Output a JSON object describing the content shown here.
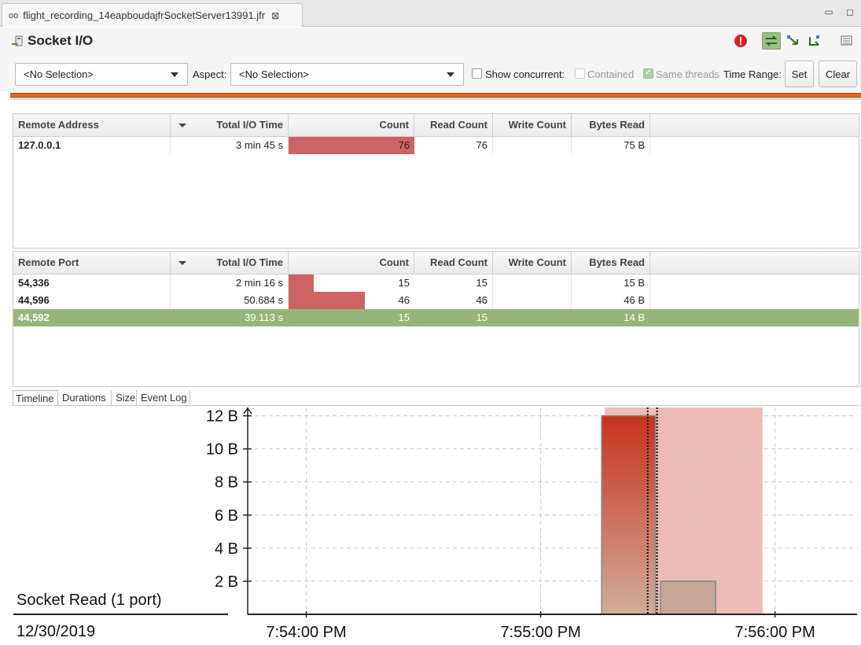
{
  "editor_tab": {
    "title": "flight_recording_14eapboudajfrSocketServer13991.jfr",
    "close_glyph": "⊠"
  },
  "window_controls": {
    "minimize": "▭",
    "maximize": "◻"
  },
  "page": {
    "title": "Socket I/O"
  },
  "filter": {
    "primary_combo": "<No Selection>",
    "aspect_label": "Aspect:",
    "aspect_combo": "<No Selection>",
    "show_concurrent": "Show concurrent:",
    "contained": "Contained",
    "same_threads": "Same threads",
    "time_range": "Time Range:",
    "set": "Set",
    "clear": "Clear"
  },
  "address_table": {
    "columns": [
      "Remote Address",
      "Total I/O Time",
      "Count",
      "Read Count",
      "Write Count",
      "Bytes Read"
    ],
    "rows": [
      {
        "remote": "127.0.0.1",
        "total_io_time": "3 min 45 s",
        "count": "76",
        "count_fraction": 1.0,
        "read_count": "76",
        "write_count": "",
        "bytes_read": "75 B"
      }
    ]
  },
  "port_table": {
    "columns": [
      "Remote Port",
      "Total I/O Time",
      "Count",
      "Read Count",
      "Write Count",
      "Bytes Read"
    ],
    "rows": [
      {
        "remote": "54,336",
        "total_io_time": "2 min 16 s",
        "count": "15",
        "count_fraction": 0.1974,
        "read_count": "15",
        "write_count": "",
        "bytes_read": "15 B"
      },
      {
        "remote": "44,596",
        "total_io_time": "50.684 s",
        "count": "46",
        "count_fraction": 0.6053,
        "read_count": "46",
        "write_count": "",
        "bytes_read": "46 B"
      },
      {
        "remote": "44,592",
        "total_io_time": "39.113 s",
        "count": "15",
        "count_fraction": 0.1974,
        "read_count": "15",
        "write_count": "",
        "bytes_read": "14 B",
        "selected": true
      }
    ]
  },
  "bottom_tabs": [
    "Timeline",
    "Durations",
    "Size",
    "Event Log"
  ],
  "colors": {
    "accent_range": "#e8641e",
    "selection": "#96b57a",
    "count_bar": "#cd6464"
  },
  "chart_data": {
    "type": "bar",
    "lane_label": "Socket Read (1 port)",
    "date_label": "12/30/2019",
    "x_ticks": [
      "7:54:00 PM",
      "7:55:00 PM",
      "7:56:00 PM"
    ],
    "x_tick_seconds": [
      0,
      60,
      120
    ],
    "y_ticks": [
      "2 B",
      "4 B",
      "6 B",
      "8 B",
      "10 B",
      "12 B"
    ],
    "y_tick_values": [
      2,
      4,
      6,
      8,
      10,
      12
    ],
    "xlim_seconds": [
      -15,
      141
    ],
    "ylim": [
      0,
      12.6
    ],
    "grid": true,
    "bars": [
      {
        "start_s": 75.6,
        "end_s": 89.4,
        "value": 12,
        "style": "gradient"
      },
      {
        "start_s": 90.7,
        "end_s": 104.8,
        "value": 2,
        "style": "flat"
      }
    ],
    "selection_band_s": [
      76.4,
      116.8
    ],
    "markers_s": [
      87.4,
      89.8
    ]
  }
}
